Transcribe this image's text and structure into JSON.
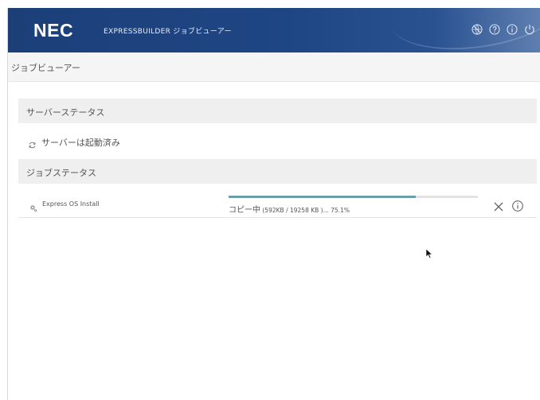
{
  "header": {
    "brand": "NEC",
    "product_name": "EXPRESSBUILDER ジョブビューアー",
    "icons": [
      "globe-slash-icon",
      "help-icon",
      "info-icon",
      "power-icon"
    ]
  },
  "page": {
    "title": "ジョブビューアー"
  },
  "server_status": {
    "heading": "サーバーステータス",
    "status_icon": "refresh-icon",
    "status_text": "サーバーは起動済み"
  },
  "job_status": {
    "heading": "ジョブステータス",
    "jobs": [
      {
        "icon": "gear-icon",
        "name": "Express OS Install",
        "state": "コピー中",
        "detail": " (592KB / 19258 KB )... 75.1%",
        "progress": 0.751,
        "actions": [
          "cancel",
          "info"
        ]
      }
    ]
  },
  "colors": {
    "header_bg": "#1f4685",
    "progress_fill": "#6d9faa",
    "section_bg": "#efefef"
  }
}
